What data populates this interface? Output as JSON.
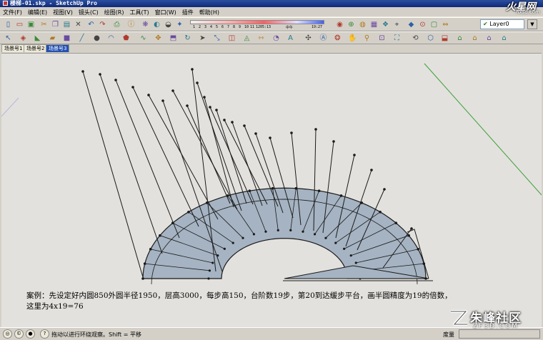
{
  "window": {
    "title": "楼梯-01.skp - SketchUp Pro"
  },
  "menu": [
    "文件(F)",
    "编辑(E)",
    "视图(V)",
    "镜头(C)",
    "绘图(R)",
    "工具(T)",
    "窗口(W)",
    "插件",
    "帮助(H)"
  ],
  "shadow_slider": {
    "ticks": [
      "1",
      "2",
      "3",
      "4",
      "5",
      "6",
      "7",
      "8",
      "9",
      "10",
      "11",
      "12"
    ],
    "time_start": "05:13",
    "noon": "中午",
    "time_end": "19:27"
  },
  "layer": {
    "name": "Layer0"
  },
  "scenes": {
    "tabs": [
      "场景号1",
      "场景号2",
      "场景号3"
    ],
    "active_index": 2
  },
  "caption": {
    "line1": "案例：先设定好内圆850外圆半径1950，层高3000，每步高150，台阶数19步，第20到达缓步平台，画半圆精度为19的倍数，",
    "line2": "这里为4x19=76"
  },
  "status": {
    "hint": "拖动以进行环绕观察。Shift = 平移",
    "measure_label": "度量",
    "measure_value": ""
  },
  "watermarks": {
    "top_brand": "火星网",
    "top_url": "hxsd.com",
    "bottom_brand": "朱峰社区",
    "bottom_url": "ZF3D.COM"
  },
  "colors": {
    "viewport_bg": "#e3e1dd",
    "stair_fill": "#a5b3c2",
    "stair_stroke": "#1a1a1a",
    "axis_green": "#3aa03a"
  },
  "toolbar1_icons": [
    "new-file-icon",
    "open-file-icon",
    "save-icon",
    "cut-icon",
    "copy-icon",
    "paste-icon",
    "erase-icon",
    "undo-icon",
    "redo-icon",
    "print-icon",
    "model-info-icon",
    "walkthrough-icon",
    "shadow-icon",
    "fog-icon",
    "solar-north-icon",
    "camera-icon",
    "geo-icon",
    "google-earth-icon",
    "gallery-icon",
    "components-icon",
    "location-icon",
    "ruby-icon",
    "toggle-icon",
    "lock-icon",
    "dimension-icon"
  ],
  "toolbar2_icons": [
    "select-icon",
    "make-component-icon",
    "paint-bucket-icon",
    "eraser-icon",
    "rectangle-icon",
    "line-icon",
    "circle-icon",
    "arc-icon",
    "polygon-icon",
    "freehand-icon",
    "move-icon",
    "push-pull-icon",
    "rotate-icon",
    "follow-me-icon",
    "scale-icon",
    "offset-icon",
    "tape-measure-icon",
    "dimension-tool-icon",
    "protractor-icon",
    "text-icon",
    "axes-icon",
    "3d-text-icon",
    "orbit-icon",
    "pan-icon",
    "zoom-icon",
    "zoom-window-icon",
    "zoom-extents-icon",
    "previous-view-icon",
    "iso-view-icon",
    "top-view-icon",
    "front-view-icon",
    "right-view-icon",
    "back-view-icon",
    "left-view-icon"
  ]
}
